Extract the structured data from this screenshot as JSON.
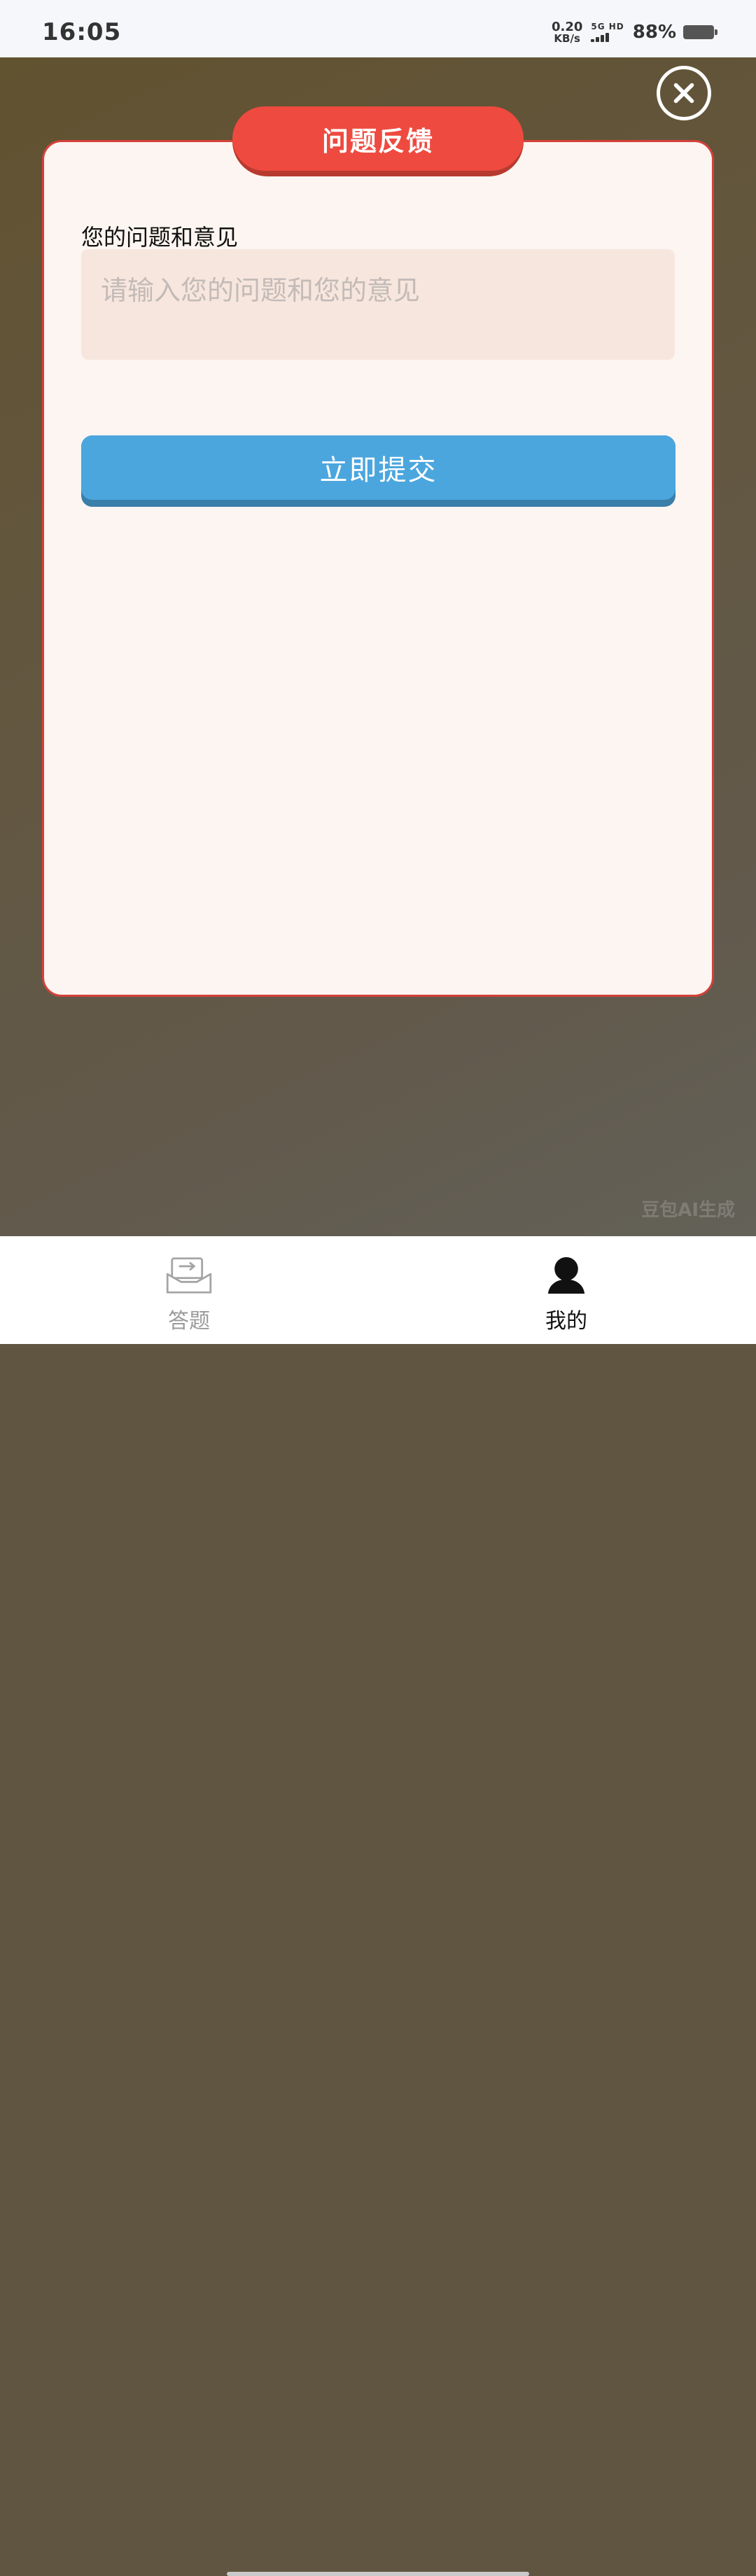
{
  "status_bar": {
    "time": "16:05",
    "net_speed_value": "0.20",
    "net_speed_unit": "KB/s",
    "network_label": "5G HD",
    "battery_text": "88%",
    "battery_level": 0.88
  },
  "dialog": {
    "title": "问题反馈",
    "field_label": "您的问题和意见",
    "input_placeholder": "请输入您的问题和您的意见",
    "input_value": "",
    "submit_label": "立即提交"
  },
  "watermark": "豆包AI生成",
  "bottom_nav": {
    "items": [
      {
        "label": "答题",
        "icon": "inbox-icon",
        "active": false
      },
      {
        "label": "我的",
        "icon": "user-icon",
        "active": true
      }
    ]
  },
  "colors": {
    "title_red": "#ee4a3f",
    "submit_blue": "#4ba6de",
    "dialog_bg": "#fdf5f1",
    "input_bg": "#f7e6dd"
  }
}
